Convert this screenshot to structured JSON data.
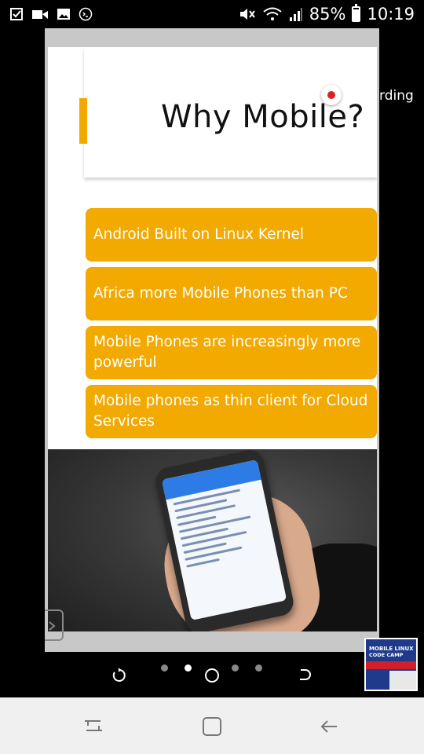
{
  "status_bar": {
    "battery": "85%",
    "battery_level": 0.85,
    "time": "10:19",
    "left_icons": [
      "checkbox-icon",
      "video-camera-icon",
      "image-icon",
      "terminal-icon"
    ],
    "right_icons": [
      "mute-icon",
      "wifi-icon",
      "signal-icon",
      "battery-icon"
    ]
  },
  "slide": {
    "title": "Why Mobile?",
    "bullets": [
      "Android Built on Linux Kernel",
      "Africa more Mobile Phones than PC",
      "Mobile  Phones are increasingly more powerful",
      "Mobile  phones as thin client for Cloud Services"
    ]
  },
  "recording": {
    "label": "rding"
  },
  "thumbnail": {
    "line1": "MOBILE LINUX",
    "line2": "CODE CAMP"
  },
  "pager": {
    "count": 5,
    "active_index": 1
  },
  "colors": {
    "accent": "#f2a900",
    "record": "#e02020",
    "background": "#000000"
  }
}
